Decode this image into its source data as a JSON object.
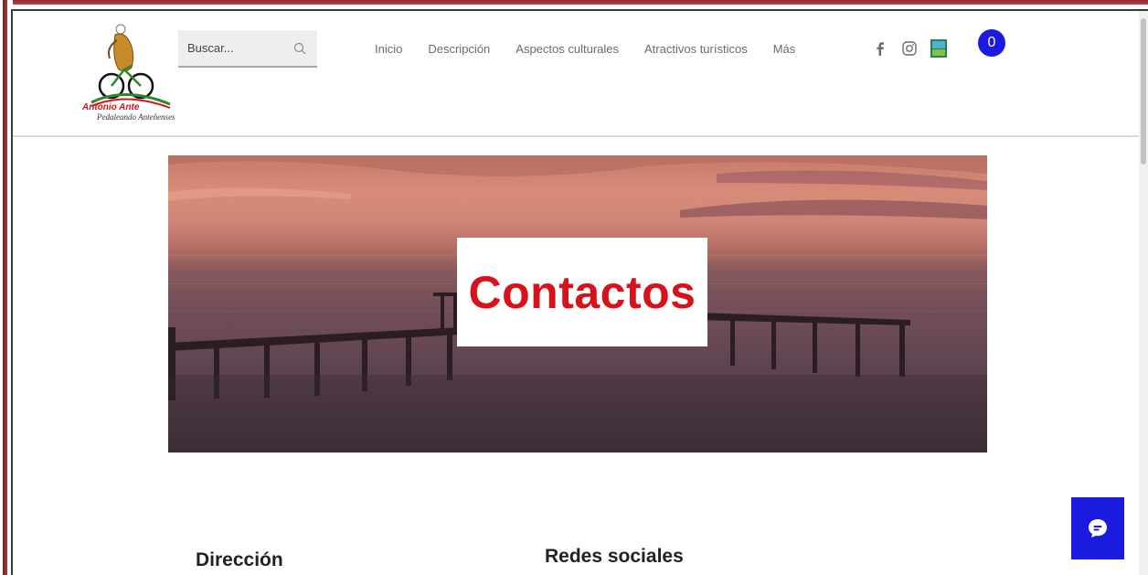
{
  "brand": {
    "name_line1": "Antonio Ante",
    "name_line2": "Pedaleando Anteñenses"
  },
  "search": {
    "placeholder": "Buscar..."
  },
  "nav": {
    "items": [
      {
        "label": "Inicio"
      },
      {
        "label": "Descripción"
      },
      {
        "label": "Aspectos culturales"
      },
      {
        "label": "Atractivos turísticos"
      },
      {
        "label": "Más"
      }
    ]
  },
  "social_icons": [
    "facebook-icon",
    "instagram-icon",
    "tourism-badge-icon"
  ],
  "cart": {
    "count": "0"
  },
  "hero": {
    "title": "Contactos"
  },
  "sections": {
    "address_title": "Dirección",
    "social_title": "Redes sociales"
  },
  "colors": {
    "accent_red": "#d8121b",
    "accent_blue": "#1b1be0",
    "nav_text": "#6b6b6b"
  }
}
